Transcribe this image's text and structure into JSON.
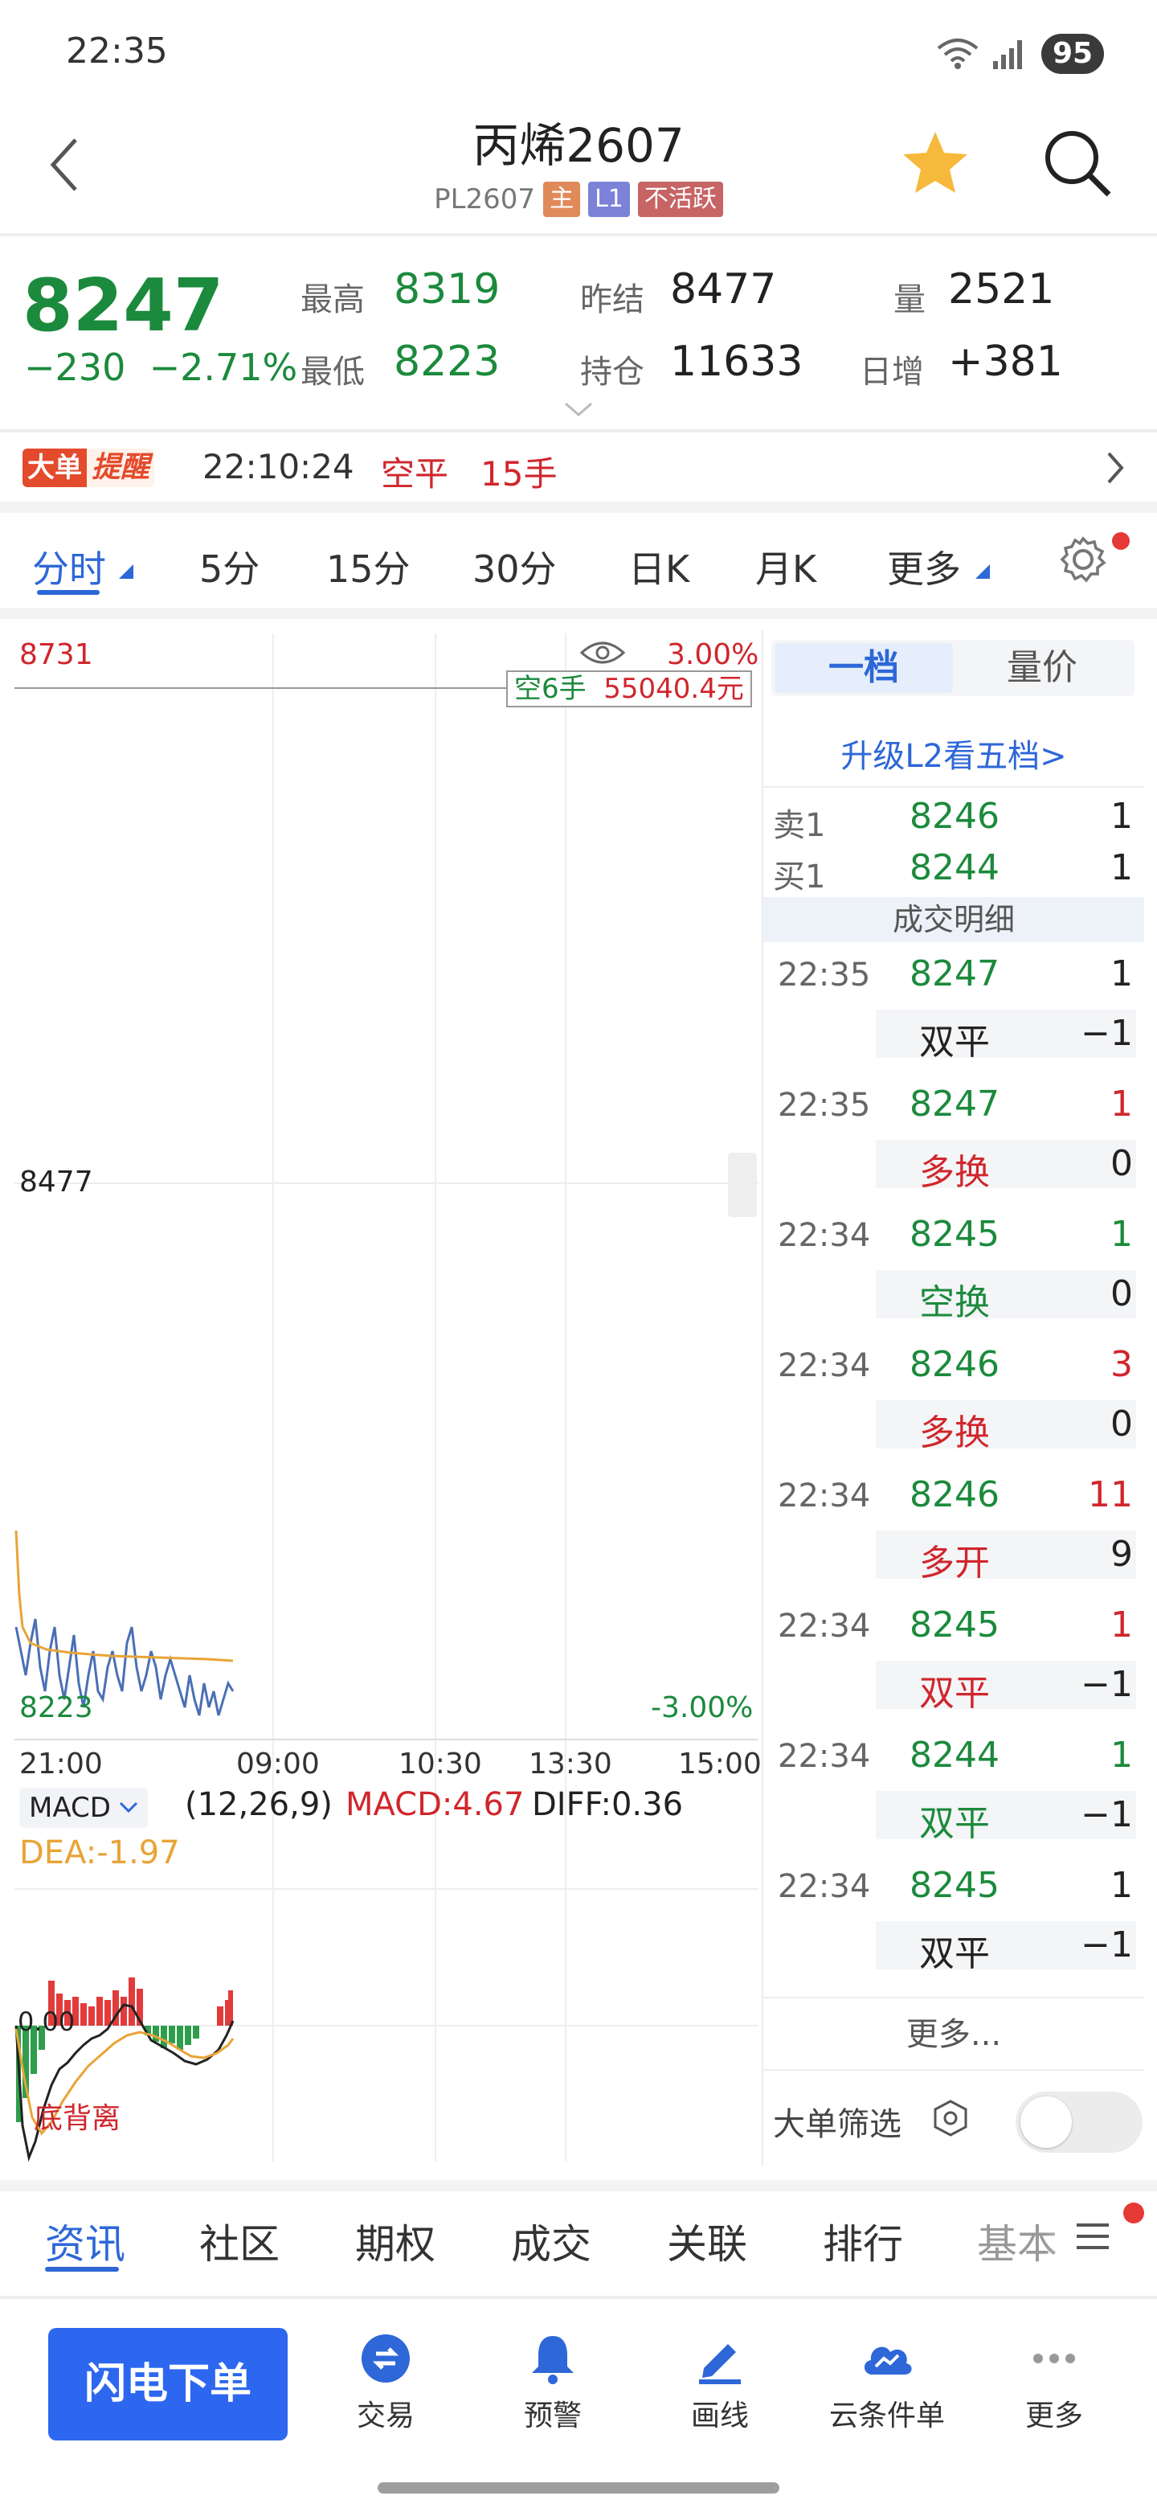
{
  "status_bar": {
    "time": "22:35",
    "battery": "95"
  },
  "header": {
    "title": "丙烯2607",
    "code": "PL2607",
    "tags": [
      {
        "label": "主",
        "color": "#e08a5a"
      },
      {
        "label": "L1",
        "color": "#7b82d8"
      },
      {
        "label": "不活跃",
        "color": "#c76464"
      }
    ]
  },
  "quote": {
    "last": "8247",
    "change": "−230",
    "change_pct": "−2.71%",
    "high_label": "最高",
    "high": "8319",
    "low_label": "最低",
    "low": "8223",
    "prev_settle_label": "昨结",
    "prev_settle": "8477",
    "open_interest_label": "持仓",
    "open_interest": "11633",
    "volume_label": "量",
    "volume": "2521",
    "daily_change_label": "日增",
    "daily_change": "+381"
  },
  "alert": {
    "badge_a": "大单",
    "badge_b": "提醒",
    "time": "22:10:24",
    "type": "空平",
    "qty": "15手"
  },
  "period_tabs": [
    "分时",
    "5分",
    "15分",
    "30分",
    "日K",
    "月K",
    "更多"
  ],
  "chart": {
    "top_price": "8731",
    "mid_price": "8477",
    "low_price": "8223",
    "top_pct": "3.00%",
    "low_pct": "-3.00%",
    "tooltip_a": "空6手",
    "tooltip_b": "55040.4元",
    "time_axis": [
      "21:00",
      "09:00",
      "10:30",
      "13:30",
      "15:00"
    ],
    "indicator": "MACD",
    "params": "(12,26,9)",
    "macd": "MACD:4.67",
    "diff": "DIFF:0.36",
    "dea": "DEA:-1.97",
    "macd_zero": "0.00",
    "divergence": "底背离"
  },
  "chart_data": {
    "type": "line",
    "title": "",
    "x_range": [
      "21:00",
      "15:00"
    ],
    "ylim": [
      8223,
      8731
    ],
    "reference": 8477,
    "series": []
  },
  "orderbook": {
    "tab_level1": "一档",
    "tab_volume_price": "量价",
    "upgrade": "升级L2看五档>",
    "ask_label": "卖1",
    "ask_price": "8246",
    "ask_qty": "1",
    "bid_label": "买1",
    "bid_price": "8244",
    "bid_qty": "1",
    "trades_header": "成交明细",
    "trades": [
      {
        "time": "22:35",
        "price": "8247",
        "qty": "1",
        "type": "双平",
        "oi": "−1"
      },
      {
        "time": "22:35",
        "price": "8247",
        "qty": "1",
        "type": "多换",
        "oi": "0"
      },
      {
        "time": "22:34",
        "price": "8245",
        "qty": "1",
        "type": "空换",
        "oi": "0"
      },
      {
        "time": "22:34",
        "price": "8246",
        "qty": "3",
        "type": "多换",
        "oi": "0"
      },
      {
        "time": "22:34",
        "price": "8246",
        "qty": "11",
        "type": "多开",
        "oi": "9"
      },
      {
        "time": "22:34",
        "price": "8245",
        "qty": "1",
        "type": "双平",
        "oi": "−1"
      },
      {
        "time": "22:34",
        "price": "8244",
        "qty": "1",
        "type": "双平",
        "oi": "−1"
      },
      {
        "time": "22:34",
        "price": "8245",
        "qty": "1",
        "type": "双平",
        "oi": "−1"
      }
    ],
    "more": "更多...",
    "big_filter": "大单筛选"
  },
  "bottom_tabs": [
    "资讯",
    "社区",
    "期权",
    "成交",
    "关联",
    "排行",
    "基本"
  ],
  "toolbar": {
    "flash_order": "闪电下单",
    "tools": [
      "交易",
      "预警",
      "画线",
      "云条件单",
      "更多"
    ]
  },
  "colors": {
    "up": "#d0262c",
    "down": "#1b8a3c",
    "accent": "#2d67d8"
  }
}
